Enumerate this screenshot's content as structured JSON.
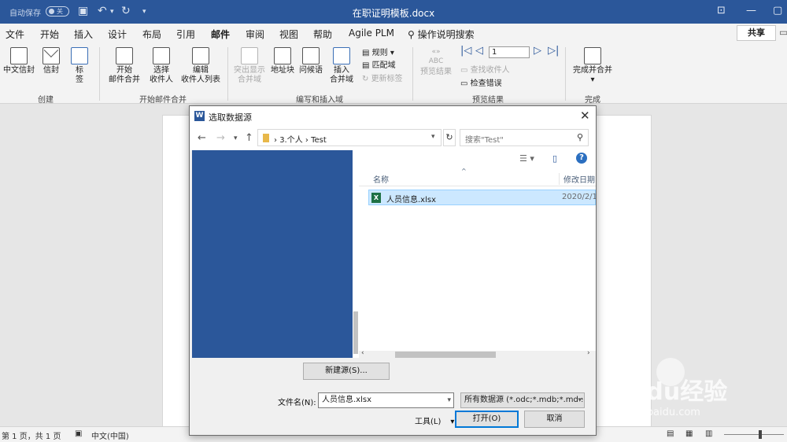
{
  "titlebar": {
    "autosave_label": "自动保存",
    "autosave_state": "关",
    "doc_title": "在职证明模板.docx"
  },
  "ribbon_tabs": [
    "文件",
    "开始",
    "插入",
    "设计",
    "布局",
    "引用",
    "邮件",
    "审阅",
    "视图",
    "帮助",
    "Agile PLM"
  ],
  "active_tab": "邮件",
  "tell_me": "操作说明搜索",
  "share_label": "共享",
  "ribbon": {
    "create": {
      "chinese_envelope": "中文信封",
      "envelope": "信封",
      "labels_1": "标",
      "labels_2": "签",
      "group": "创建"
    },
    "start": {
      "start_1": "开始",
      "start_2": "邮件合并",
      "select_1": "选择",
      "select_2": "收件人",
      "edit_1": "编辑",
      "edit_2": "收件人列表",
      "group": "开始邮件合并"
    },
    "write": {
      "highlight_1": "突出显示",
      "highlight_2": "合并域",
      "address": "地址块",
      "greeting": "问候语",
      "insert_1": "插入",
      "insert_2": "合并域",
      "rules": "规则",
      "match": "匹配域",
      "update": "更新标签",
      "group": "编写和插入域"
    },
    "preview": {
      "preview_results": "预览结果",
      "abc": "ABC",
      "record": "1",
      "find": "查找收件人",
      "check": "检查错误",
      "group": "预览结果"
    },
    "finish": {
      "finish_1": "完成并合并",
      "group": "完成"
    }
  },
  "statusbar": {
    "page": "第 1 页，共 1 页",
    "lang": "中文(中国)"
  },
  "dialog": {
    "title": "选取数据源",
    "path": [
      "3.个人",
      "Test"
    ],
    "search_placeholder": "搜索\"Test\"",
    "columns": {
      "name": "名称",
      "date": "修改日期"
    },
    "files": [
      {
        "name": "人员信息.xlsx",
        "date": "2020/2/1"
      }
    ],
    "new_source": "新建源(S)...",
    "filename_label": "文件名(N):",
    "filename_value": "人员信息.xlsx",
    "filetype": "所有数据源 (*.odc;*.mdb;*.mde",
    "tools": "工具(L)",
    "open": "打开(O)",
    "cancel": "取消"
  },
  "watermark": {
    "brand": "Baidu经验",
    "url": "jingyan.baidu.com"
  }
}
